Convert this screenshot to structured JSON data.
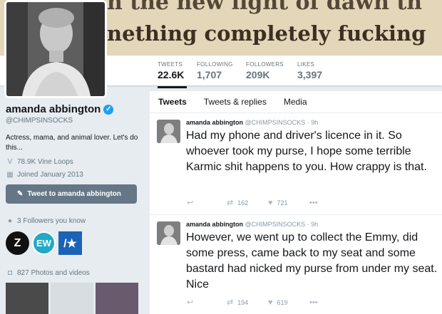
{
  "banner": {
    "line1": "n the new light of dawn th",
    "line2": "nething completely fucking"
  },
  "stats": [
    {
      "label": "TWEETS",
      "value": "22.6K"
    },
    {
      "label": "FOLLOWING",
      "value": "1,707"
    },
    {
      "label": "FOLLOWERS",
      "value": "209K"
    },
    {
      "label": "LIKES",
      "value": "3,397"
    }
  ],
  "profile": {
    "name": "amanda abbington",
    "handle": "@CHIMPSINSOCKS",
    "bio": "Actress, mama, and animal lover. Let's do this...",
    "vine_loops": "78.9K Vine Loops",
    "joined": "Joined January 2013",
    "tweet_to_label": "Tweet to amanda abbington",
    "followers_you_know": "3 Followers you know",
    "photos_videos": "827 Photos and videos"
  },
  "followers_known": [
    "Z",
    "EW",
    "/★"
  ],
  "tabs": [
    {
      "label": "Tweets"
    },
    {
      "label": "Tweets & replies"
    },
    {
      "label": "Media"
    }
  ],
  "tweets": [
    {
      "name": "amanda abbington",
      "handle": "@CHIMPSINSOCKS",
      "time": "9h",
      "text": "Had my phone and driver's licence in it. So whoever took my purse, I hope some terrible Karmic shit happens to you. How crappy is that.",
      "retweets": "162",
      "likes": "721"
    },
    {
      "name": "amanda abbington",
      "handle": "@CHIMPSINSOCKS",
      "time": "9h",
      "text": "However, we went up to collect the Emmy, did some press, came back to my seat and some bastard had nicked my purse from under my seat. Nice",
      "retweets": "194",
      "likes": "619"
    }
  ],
  "colors": {
    "verified": "#1da1f2",
    "button": "#657786",
    "muted": "#66757f"
  },
  "icons": [
    "verified-icon",
    "vine-icon",
    "calendar-icon",
    "tweet-compose-icon",
    "person-icon",
    "camera-icon",
    "reply-icon",
    "retweet-icon",
    "like-icon",
    "more-icon"
  ]
}
